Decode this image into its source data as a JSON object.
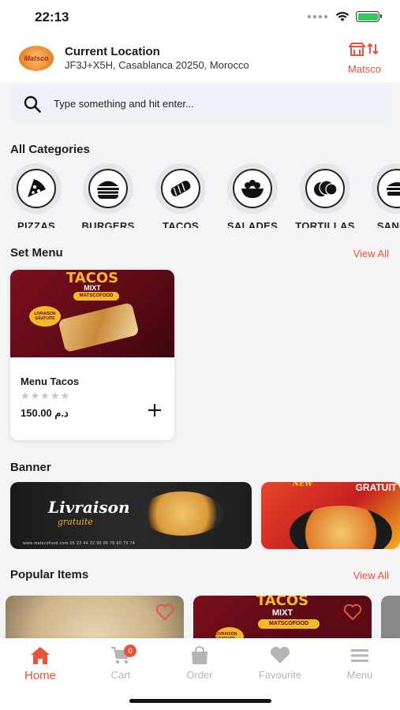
{
  "status_bar": {
    "time": "22:13"
  },
  "header": {
    "logo_text": "Matsco",
    "location_title": "Current Location",
    "location_address": "JF3J+X5H, Casablanca 20250, Morocco",
    "store_label": "Matsco"
  },
  "search": {
    "placeholder": "Type something and hit enter..."
  },
  "categories": {
    "title": "All Categories",
    "items": [
      {
        "label": "PIZZAS",
        "icon": "pizza-icon"
      },
      {
        "label": "BURGERS",
        "icon": "burger-icon"
      },
      {
        "label": "TACOS",
        "icon": "tacos-icon"
      },
      {
        "label": "SALADES",
        "icon": "salad-icon"
      },
      {
        "label": "TORTILLAS",
        "icon": "tortilla-icon"
      },
      {
        "label": "SANDW",
        "icon": "sandwich-icon"
      }
    ]
  },
  "set_menu": {
    "title": "Set Menu",
    "view_all": "View All",
    "items": [
      {
        "name": "Menu Tacos",
        "price": "150.00 د.م",
        "rating": 0,
        "stars": "★★★★★",
        "image_title": "TACOS",
        "image_subtitle": "MIXT",
        "image_pill": "MATSCOFOOD",
        "image_badge": "LIVRAISON GRATUITE"
      }
    ]
  },
  "banner": {
    "title": "Banner",
    "items": [
      {
        "script": "Livraison",
        "script_sub": "gratuite",
        "footer": "www.matscofood.com   05 22 44 22 90   06 70 60 79 74"
      },
      {
        "tag": "NEW",
        "headline": "GRATUIT"
      }
    ]
  },
  "popular": {
    "title": "Popular Items",
    "view_all": "View All",
    "items": [
      {
        "image": "pizza"
      },
      {
        "image_title": "TACOS",
        "image_subtitle": "MIXT",
        "image_pill": "MATSCOFOOD",
        "image_badge": "LIVRAISON GRATUITE"
      },
      {
        "image": "partial"
      }
    ]
  },
  "tabbar": {
    "items": [
      {
        "label": "Home",
        "icon": "home-icon",
        "active": true
      },
      {
        "label": "Cart",
        "icon": "cart-icon",
        "badge": "0"
      },
      {
        "label": "Order",
        "icon": "shopping-bag-icon"
      },
      {
        "label": "Favourite",
        "icon": "heart-icon"
      },
      {
        "label": "Menu",
        "icon": "menu-icon"
      }
    ]
  },
  "colors": {
    "accent": "#e8533a",
    "background": "#f4f4f6",
    "search_bg": "#edf1f8",
    "inactive_tab": "#b5b5b5"
  }
}
